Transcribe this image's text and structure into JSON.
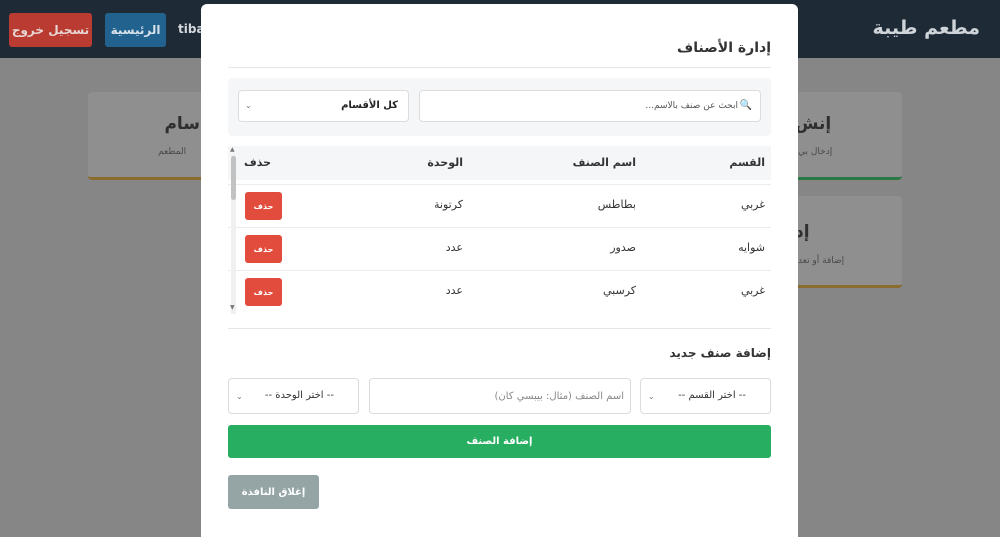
{
  "app": {
    "brand": "مطعم طيبة",
    "logout_label": "تسجيل خروج",
    "home_label": "الرئيسية",
    "user": "tiba"
  },
  "background_cards": [
    {
      "title": "سام",
      "subtitle": "المطعم"
    },
    {
      "title": "إنش",
      "subtitle": "إدخال بي"
    },
    {
      "title": "إد",
      "subtitle": "إضافة أو تعد"
    }
  ],
  "modal": {
    "title": "إدارة الأصناف",
    "search_placeholder": "ابحث عن صنف بالاسم...",
    "category_filter": "كل الأقسام",
    "table": {
      "headers": {
        "category": "القسم",
        "name": "اسم الصنف",
        "unit": "الوحدة",
        "delete": "حذف"
      },
      "rows": [
        {
          "category": "غربي",
          "name": "بطاطس",
          "unit": "كرتونة",
          "delete": "حذف"
        },
        {
          "category": "شوايه",
          "name": "صدور",
          "unit": "عدد",
          "delete": "حذف"
        },
        {
          "category": "غربي",
          "name": "كرسبي",
          "unit": "عدد",
          "delete": "حذف"
        }
      ]
    },
    "add_section": {
      "title": "إضافة صنف جديد",
      "category_select": "-- اختر القسم --",
      "name_placeholder": "اسم الصنف (مثال: بيبسي كان)",
      "unit_select": "-- اختر الوحدة --",
      "add_button": "إضافة الصنف"
    },
    "close_button": "إغلاق النافذة"
  },
  "colors": {
    "danger": "#e24c3d",
    "success": "#27ae60",
    "secondary": "#95a5a6",
    "navbar": "#1e2a36"
  }
}
